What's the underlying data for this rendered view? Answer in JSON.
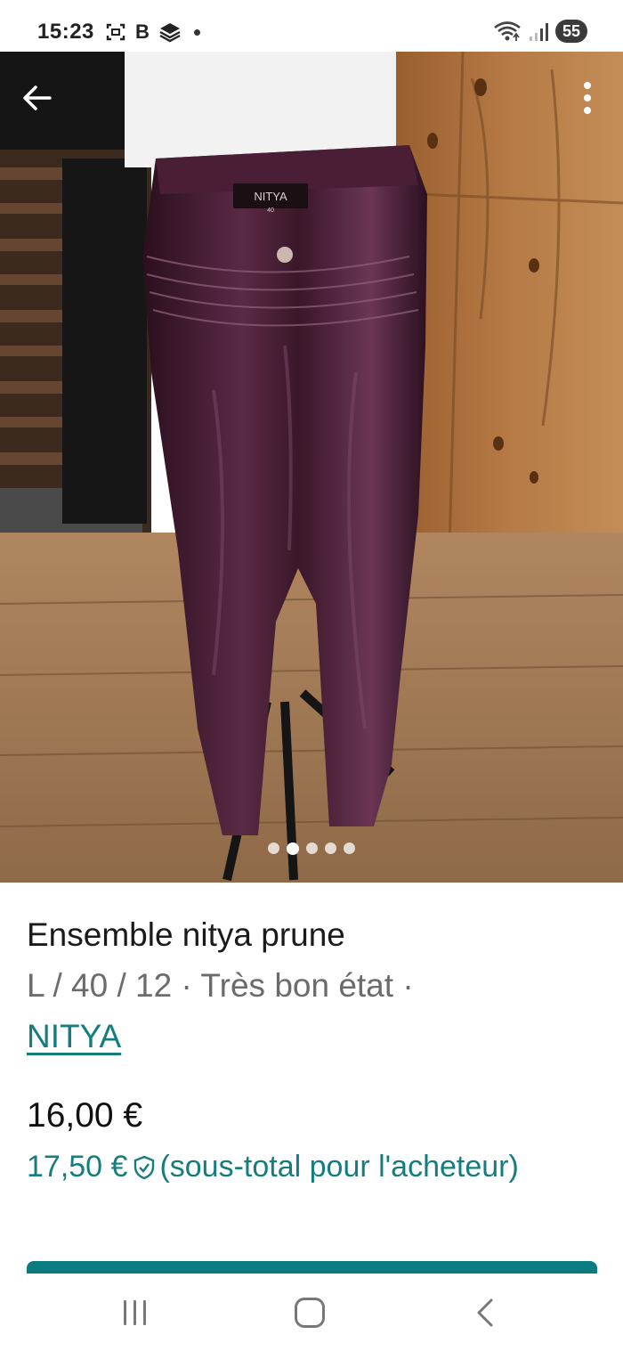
{
  "status_bar": {
    "time": "15:23",
    "left_icons": [
      "screenshot-icon",
      "b-icon",
      "stack-icon",
      "dot-icon"
    ],
    "b_glyph": "B",
    "battery": "55"
  },
  "gallery": {
    "image_count": 5,
    "active_index": 1
  },
  "listing": {
    "title": "Ensemble nitya prune",
    "details": "L / 40 / 12 · Très bon état ·",
    "brand": "NITYA",
    "price": "16,00 €",
    "buyer_price": "17,50 €",
    "buyer_note": "(sous-total pour l'acheteur)"
  },
  "product_label": {
    "brand": "NITYA",
    "size": "40"
  },
  "colors": {
    "accent": "#167d7f",
    "button": "#0a7b7e",
    "garment": "#3b1a2c"
  }
}
